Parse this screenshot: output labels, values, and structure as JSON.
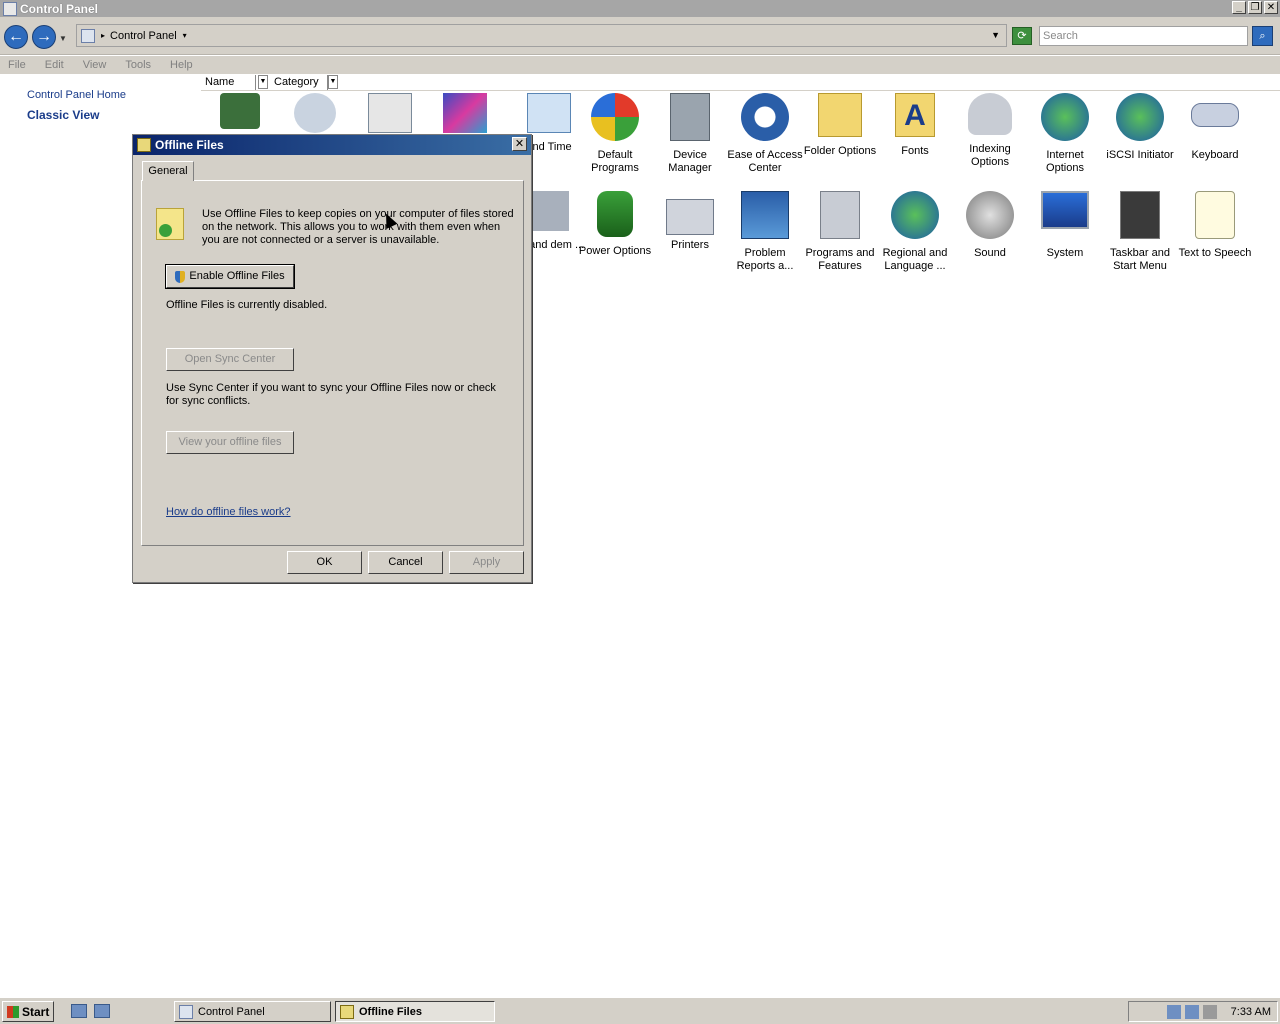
{
  "window": {
    "title": "Control Panel"
  },
  "address_bar": {
    "crumb": "Control Panel",
    "search_placeholder": "Search"
  },
  "menu": [
    "File",
    "Edit",
    "View",
    "Tools",
    "Help"
  ],
  "left_pane": {
    "home_link": "Control Panel Home",
    "classic_view": "Classic View"
  },
  "columns": {
    "name": "Name",
    "category": "Category"
  },
  "icons": [
    {
      "label": "",
      "icon": "add-hardware-icon"
    },
    {
      "label": "",
      "icon": "administrative-tools-icon"
    },
    {
      "label": "",
      "icon": "autoplay-icon"
    },
    {
      "label": "",
      "icon": "color-management-icon"
    },
    {
      "label": "and Time",
      "icon": "date-time-icon"
    },
    {
      "label": "Default Programs",
      "icon": "default-programs-icon"
    },
    {
      "label": "Device Manager",
      "icon": "device-manager-icon"
    },
    {
      "label": "Ease of Access Center",
      "icon": "ease-of-access-icon"
    },
    {
      "label": "Folder Options",
      "icon": "folder-options-icon"
    },
    {
      "label": "Fonts",
      "icon": "fonts-icon"
    },
    {
      "label": "Indexing Options",
      "icon": "indexing-options-icon"
    },
    {
      "label": "Internet Options",
      "icon": "internet-options-icon"
    },
    {
      "label": "iSCSI Initiator",
      "icon": "iscsi-initiator-icon"
    },
    {
      "label": "Keyboard",
      "icon": "keyboard-icon"
    },
    {
      "label": "ne and dem ...",
      "icon": "phone-modem-icon"
    },
    {
      "label": "Power Options",
      "icon": "power-options-icon"
    },
    {
      "label": "Printers",
      "icon": "printers-icon"
    },
    {
      "label": "Problem Reports a...",
      "icon": "problem-reports-icon"
    },
    {
      "label": "Programs and Features",
      "icon": "programs-features-icon"
    },
    {
      "label": "Regional and Language ...",
      "icon": "regional-language-icon"
    },
    {
      "label": "Sound",
      "icon": "sound-icon"
    },
    {
      "label": "System",
      "icon": "system-icon"
    },
    {
      "label": "Taskbar and Start Menu",
      "icon": "taskbar-start-menu-icon"
    },
    {
      "label": "Text to Speech",
      "icon": "text-to-speech-icon"
    }
  ],
  "dialog": {
    "title": "Offline Files",
    "tab": "General",
    "description": "Use Offline Files to keep copies on your computer of files stored on the network.  This allows you to work with them even when you are not connected or a server is unavailable.",
    "enable_button": "Enable Offline Files",
    "status": "Offline Files is currently disabled.",
    "sync_button": "Open Sync Center",
    "sync_text": "Use Sync Center if you want to sync your Offline Files now or check for sync conflicts.",
    "view_button": "View your offline files",
    "help_link": "How do offline files work?",
    "ok": "OK",
    "cancel": "Cancel",
    "apply": "Apply"
  },
  "taskbar": {
    "start": "Start",
    "tasks": [
      {
        "label": "Control Panel"
      },
      {
        "label": "Offline Files"
      }
    ],
    "clock": "7:33 AM"
  }
}
